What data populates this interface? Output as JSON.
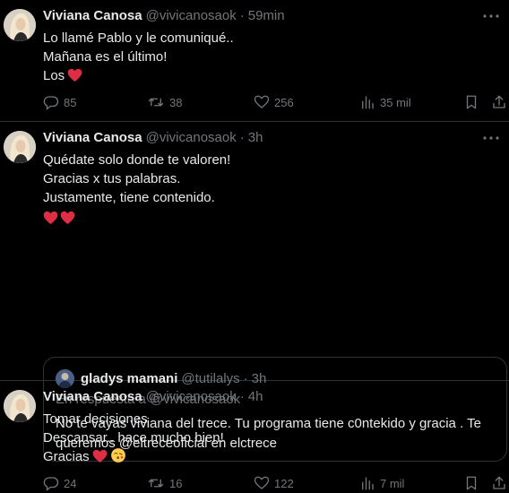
{
  "colors": {
    "background": "#000000",
    "text": "#e7e9ea",
    "secondary": "#71767b",
    "divider": "#2f3336",
    "heart": "#f4212e"
  },
  "tweets": [
    {
      "name": "Viviana Canosa",
      "handle": "@vivicanosaok",
      "separator": "·",
      "time": "59min",
      "lines": [
        "Lo llamé Pablo y le comuniqué..",
        "Mañana es el último!",
        "Los"
      ],
      "replies": "85",
      "retweets": "38",
      "likes": "256",
      "views": "35 mil"
    },
    {
      "name": "Viviana Canosa",
      "handle": "@vivicanosaok",
      "separator": "·",
      "time": "3h",
      "lines": [
        "Quédate solo donde te valoren!",
        "Gracias x tus palabras.",
        "Justamente, tiene contenido."
      ],
      "quote": {
        "name": "gladys mamani",
        "handle": "@tutilalys",
        "separator": "·",
        "time": "3h",
        "reply_to": "En respuesta a @vivicanosaok",
        "lines": [
          "No te vayas viviana del trece. Tu programa tiene c0ntekido y gracia . Te",
          "queremos @eltreceoficial en elctrece"
        ]
      },
      "replies": "24",
      "retweets": "16",
      "likes": "122",
      "views": "7 mil"
    },
    {
      "name": "Viviana Canosa",
      "handle": "@vivicanosaok",
      "separator": "·",
      "time": "4h",
      "lines": [
        "Tomar decisiones",
        "Descansar.. hace mucho bien!",
        "Gracias"
      ]
    }
  ]
}
